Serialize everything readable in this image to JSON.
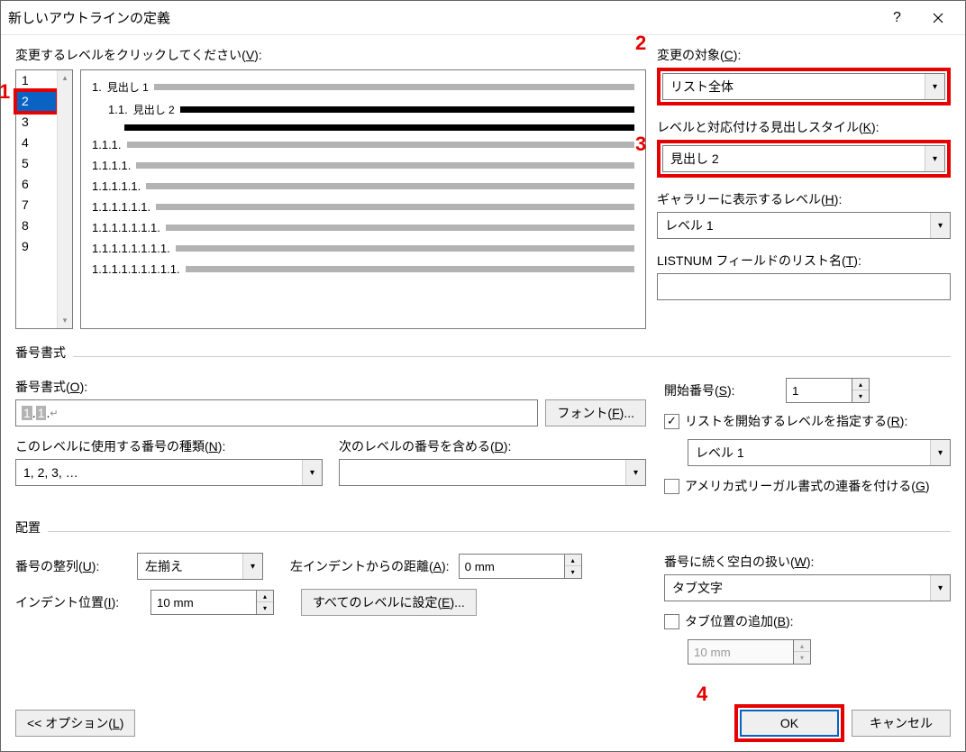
{
  "title": "新しいアウトラインの定義",
  "level_click_label": "変更するレベルをクリックしてください(V):",
  "levels": [
    "1",
    "2",
    "3",
    "4",
    "5",
    "6",
    "7",
    "8",
    "9"
  ],
  "selected_level_index": 1,
  "preview": {
    "l1": {
      "num": "1.",
      "head": "見出し 1"
    },
    "l2": {
      "num": "1.1.",
      "head": "見出し 2"
    },
    "l3": "1.1.1.",
    "l4": "1.1.1.1.",
    "l5": "1.1.1.1.1.",
    "l6": "1.1.1.1.1.1.",
    "l7": "1.1.1.1.1.1.1.",
    "l8": "1.1.1.1.1.1.1.1.",
    "l9": "1.1.1.1.1.1.1.1.1."
  },
  "right": {
    "change_target_label": "変更の対象(C):",
    "change_target_value": "リスト全体",
    "linked_style_label": "レベルと対応付ける見出しスタイル(K):",
    "linked_style_value": "見出し 2",
    "gallery_level_label": "ギャラリーに表示するレベル(H):",
    "gallery_level_value": "レベル 1",
    "listnum_label": "LISTNUM フィールドのリスト名(T):",
    "listnum_value": ""
  },
  "numfmt": {
    "section_label": "番号書式",
    "format_label": "番号書式(O):",
    "format_value_seg1": "1",
    "format_value_sep1": ".",
    "format_value_seg2": "1",
    "format_value_sep2": ".",
    "format_value_tail": "↵",
    "font_btn": "フォント(F)...",
    "number_style_label": "このレベルに使用する番号の種類(N):",
    "number_style_value": "1, 2, 3, …",
    "include_prev_label": "次のレベルの番号を含める(D):",
    "include_prev_value": "",
    "start_at_label": "開始番号(S):",
    "start_at_value": "1",
    "restart_label": "リストを開始するレベルを指定する(R):",
    "restart_value": "レベル 1",
    "legal_label": "アメリカ式リーガル書式の連番を付ける(G)"
  },
  "pos": {
    "section_label": "配置",
    "align_label": "番号の整列(U):",
    "align_value": "左揃え",
    "left_indent_label": "左インデントからの距離(A):",
    "left_indent_value": "0 mm",
    "indent_pos_label": "インデント位置(I):",
    "indent_pos_value": "10 mm",
    "set_all_btn": "すべてのレベルに設定(E)...",
    "follow_label": "番号に続く空白の扱い(W):",
    "follow_value": "タブ文字",
    "tab_add_label": "タブ位置の追加(B):",
    "tab_add_value": "10 mm"
  },
  "options_btn": "<< オプション(L)",
  "ok_btn": "OK",
  "cancel_btn": "キャンセル",
  "annot": {
    "a1": "1",
    "a2": "2",
    "a3": "3",
    "a4": "4"
  }
}
